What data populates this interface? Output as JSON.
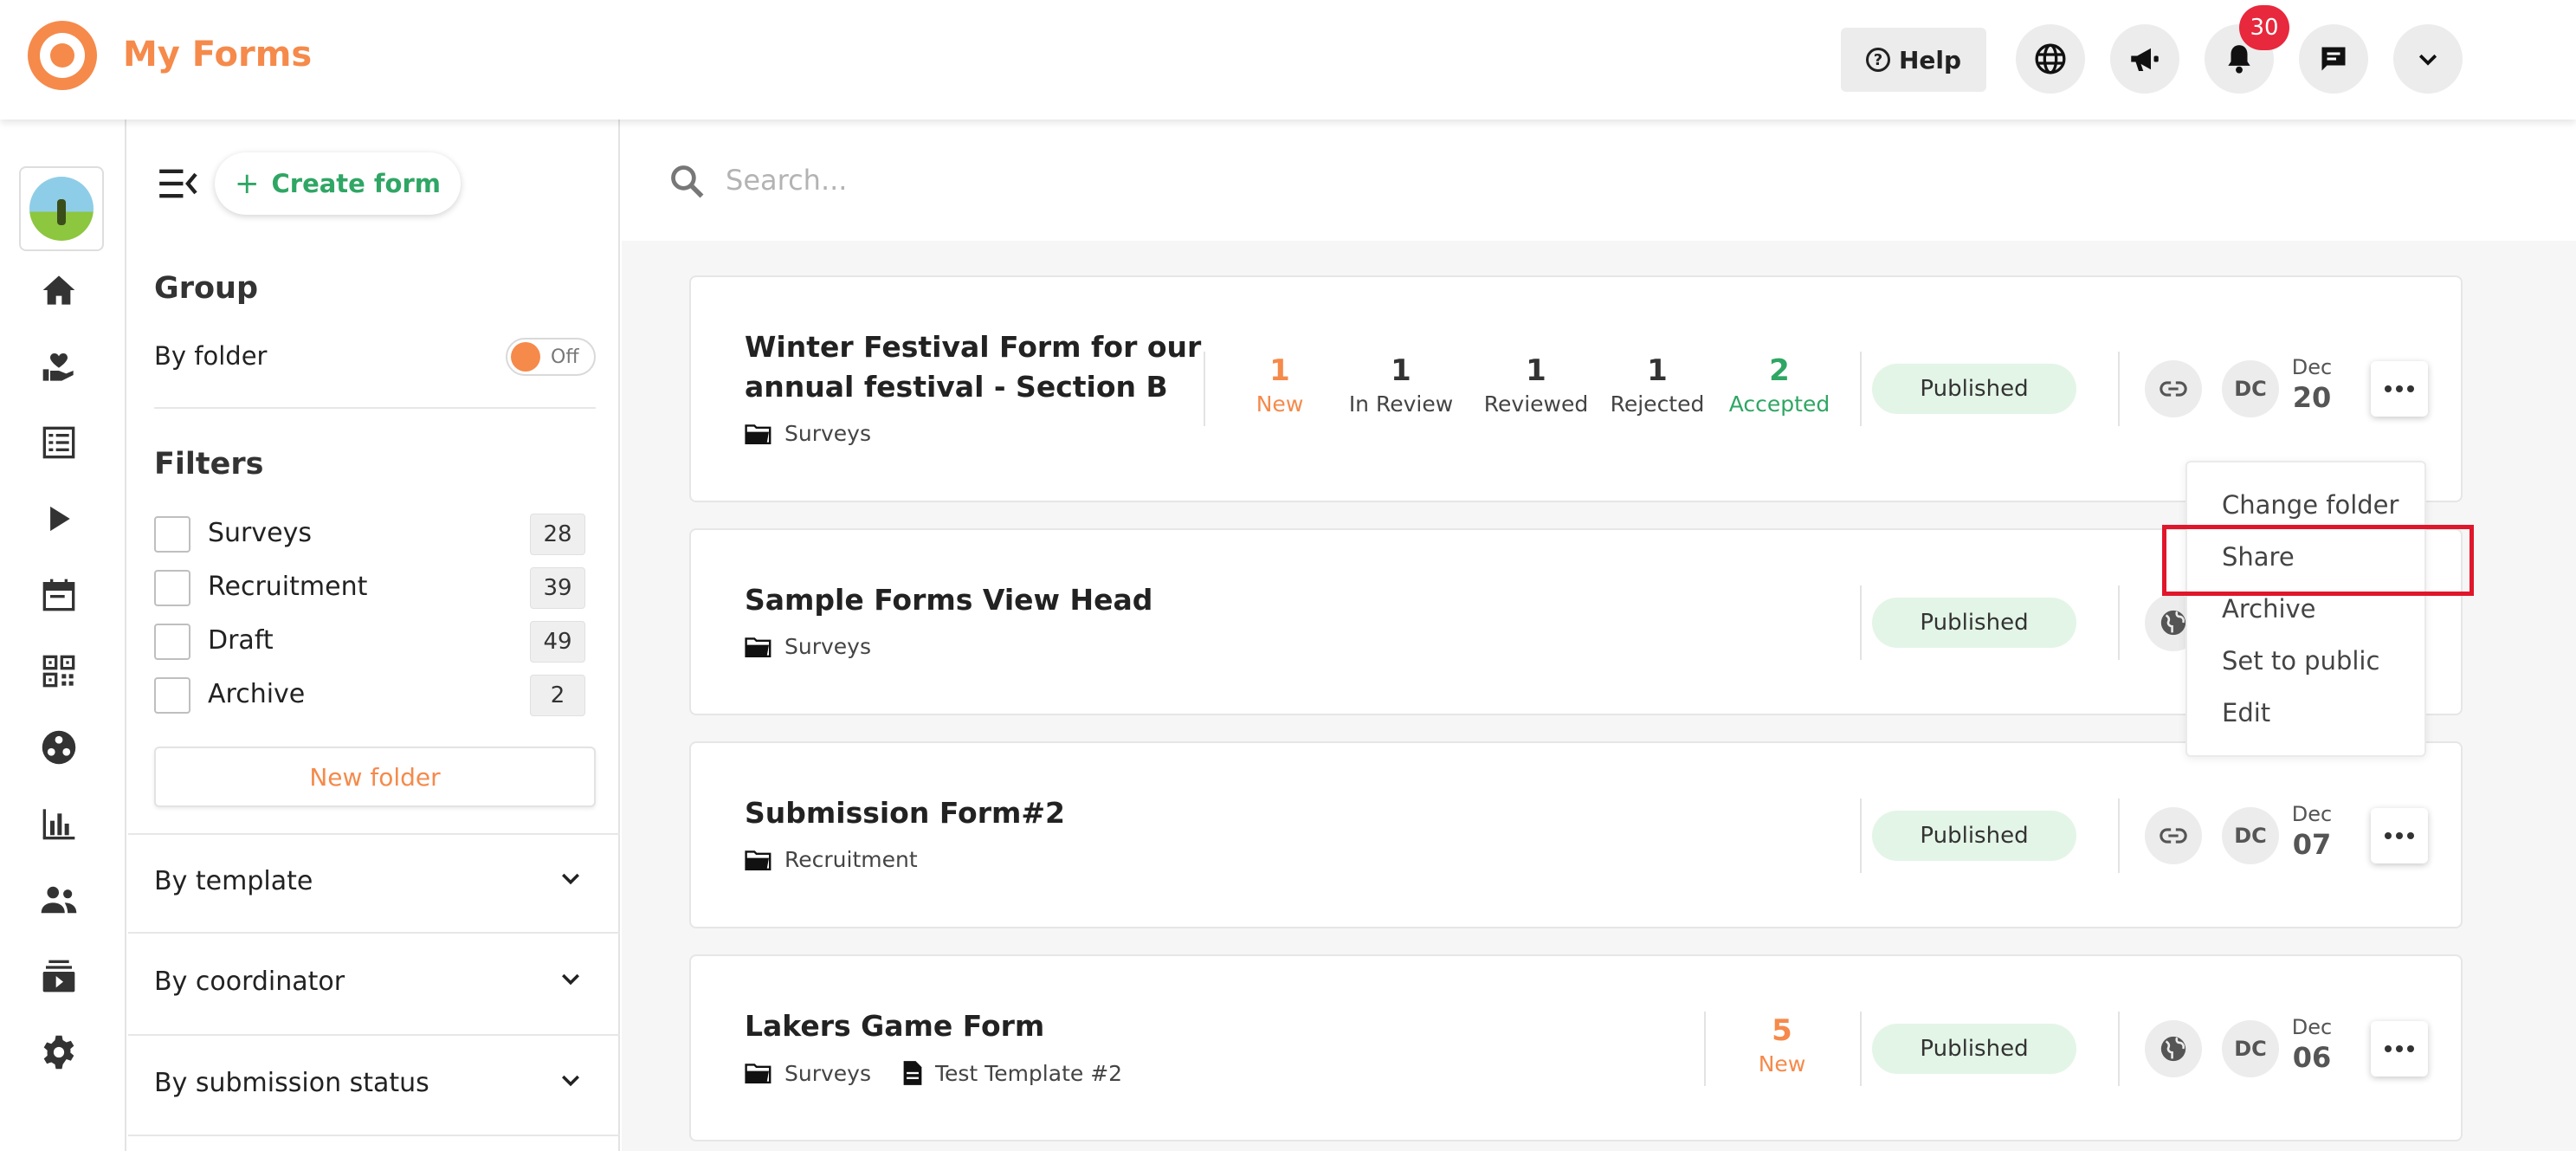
{
  "header": {
    "app_title": "My Forms",
    "help_label": "Help",
    "notification_count": "30"
  },
  "sidebar": {
    "create_label": "Create form",
    "group_title": "Group",
    "by_folder_label": "By folder",
    "toggle_label": "Off",
    "filters_title": "Filters",
    "filters": [
      {
        "label": "Surveys",
        "count": "28"
      },
      {
        "label": "Recruitment",
        "count": "39"
      },
      {
        "label": "Draft",
        "count": "49"
      },
      {
        "label": "Archive",
        "count": "2"
      }
    ],
    "new_folder_label": "New folder",
    "accordions": [
      "By template",
      "By coordinator",
      "By submission status"
    ]
  },
  "search": {
    "placeholder": "Search..."
  },
  "forms": [
    {
      "title_line1": "Winter Festival Form for our",
      "title_line2": "annual festival - Section B",
      "folder": "Surveys",
      "stats": [
        {
          "value": "1",
          "label": "New"
        },
        {
          "value": "1",
          "label": "In Review"
        },
        {
          "value": "1",
          "label": "Reviewed"
        },
        {
          "value": "1",
          "label": "Rejected"
        },
        {
          "value": "2",
          "label": "Accepted"
        }
      ],
      "status": "Published",
      "coordinator": "DC",
      "month": "Dec",
      "day": "20"
    },
    {
      "title": "Sample Forms View Head",
      "folder": "Surveys",
      "status": "Published"
    },
    {
      "title": "Submission Form#2",
      "folder": "Recruitment",
      "status": "Published",
      "coordinator": "DC",
      "month": "Dec",
      "day": "07"
    },
    {
      "title": "Lakers Game Form",
      "folder": "Surveys",
      "template": "Test Template #2",
      "stats": [
        {
          "value": "5",
          "label": "New"
        }
      ],
      "status": "Published",
      "coordinator": "DC",
      "month": "Dec",
      "day": "06"
    }
  ],
  "dropdown": {
    "items": [
      "Change folder",
      "Share",
      "Archive",
      "Set to public",
      "Edit"
    ]
  },
  "colors": {
    "brand_orange": "#f58a4b",
    "accent_green": "#2fa664",
    "published_bg": "#e3f5e7",
    "highlight_red": "#e0162b",
    "badge_red": "#e8283c"
  }
}
